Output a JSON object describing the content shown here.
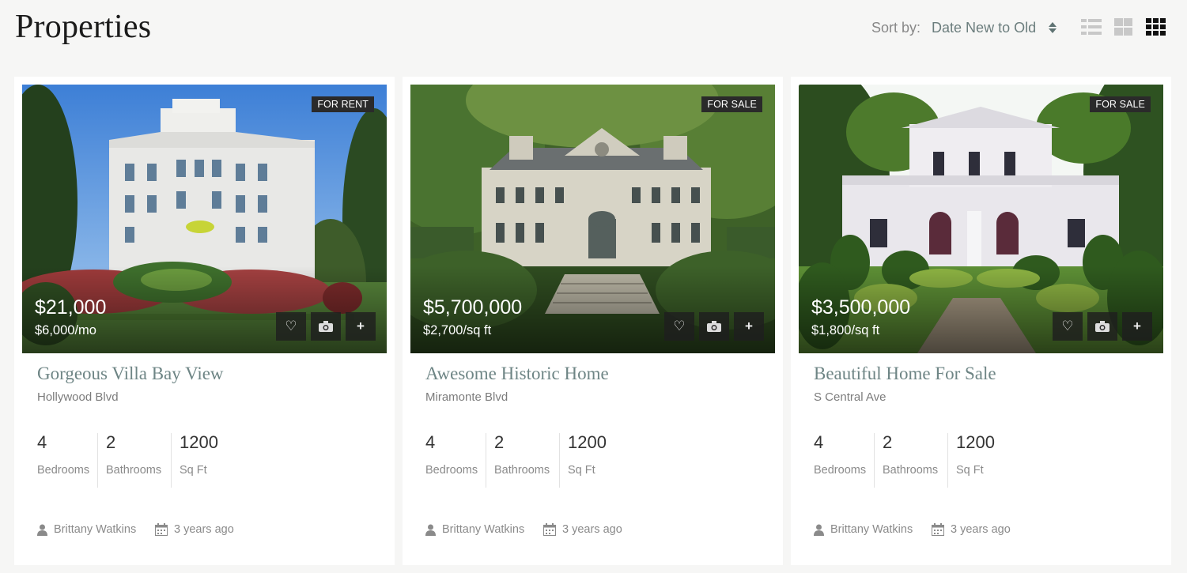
{
  "header": {
    "title": "Properties",
    "sort_label": "Sort by:",
    "sort_value": "Date New to Old"
  },
  "view_icons": [
    "list-view-icon",
    "grid-2-view-icon",
    "grid-3-view-icon"
  ],
  "labels": {
    "bedrooms": "Bedrooms",
    "bathrooms": "Bathrooms",
    "sqft": "Sq Ft"
  },
  "colors": {
    "accent_title": "#6e8585",
    "badge_bg": "#2a2a2a",
    "active_view_icon": "#111111"
  },
  "properties": [
    {
      "status": "FOR RENT",
      "price": "$21,000",
      "sub_price": "$6,000/mo",
      "title": "Gorgeous Villa Bay View",
      "address": "Hollywood Blvd",
      "bedrooms": "4",
      "bathrooms": "2",
      "sqft": "1200",
      "agent": "Brittany Watkins",
      "posted": "3 years ago"
    },
    {
      "status": "FOR SALE",
      "price": "$5,700,000",
      "sub_price": "$2,700/sq ft",
      "title": "Awesome Historic Home",
      "address": "Miramonte Blvd",
      "bedrooms": "4",
      "bathrooms": "2",
      "sqft": "1200",
      "agent": "Brittany Watkins",
      "posted": "3 years ago"
    },
    {
      "status": "FOR SALE",
      "price": "$3,500,000",
      "sub_price": "$1,800/sq ft",
      "title": "Beautiful Home For Sale",
      "address": "S Central Ave",
      "bedrooms": "4",
      "bathrooms": "2",
      "sqft": "1200",
      "agent": "Brittany Watkins",
      "posted": "3 years ago"
    }
  ]
}
